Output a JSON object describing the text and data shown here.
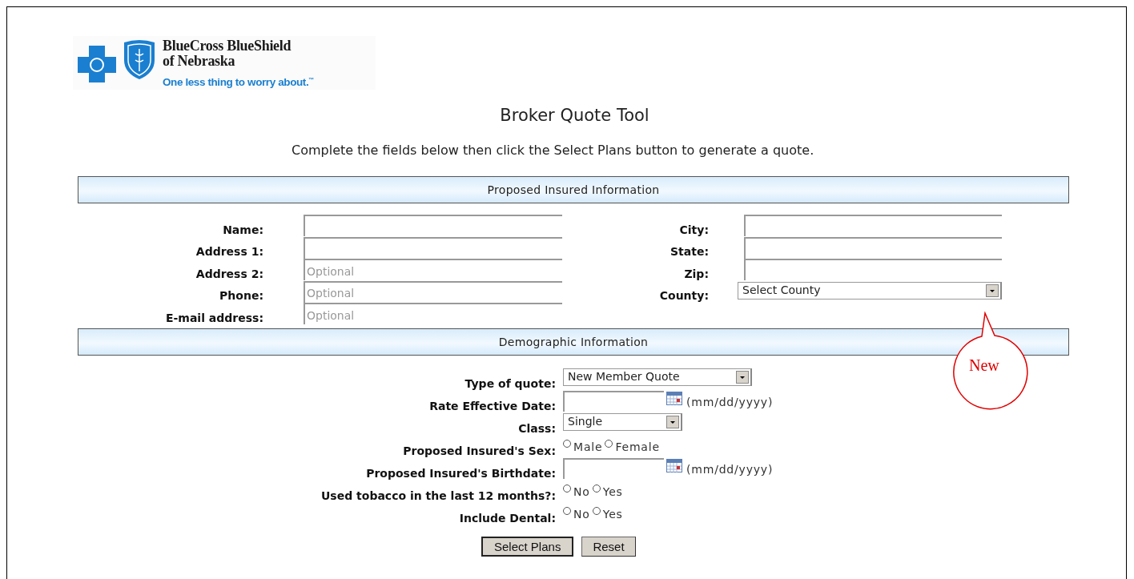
{
  "logo": {
    "line1": "BlueCross BlueShield",
    "line2": "of Nebraska",
    "tagline": "One less thing to worry about.$^{™}$"
  },
  "title": "Broker Quote Tool",
  "instructions": "Complete the fields below then click the Select Plans button to generate a quote.",
  "insured_section": {
    "heading": "Proposed Insured Information",
    "left_fields": [
      {
        "label": "Name:",
        "kind": "text"
      },
      {
        "label": "Address 1:",
        "kind": "text"
      },
      {
        "label": "Address 2:",
        "kind": "text",
        "placeholder": "Optional"
      },
      {
        "label": "Phone:",
        "kind": "text",
        "placeholder": "Optional"
      },
      {
        "label": "E-mail address:",
        "kind": "text",
        "placeholder": "Optional"
      }
    ],
    "right_fields": [
      {
        "label": "City:",
        "kind": "text"
      },
      {
        "label": "State:",
        "kind": "text"
      },
      {
        "label": "Zip:",
        "kind": "text"
      },
      {
        "label": "County:",
        "kind": "select",
        "value": "Select County"
      }
    ]
  },
  "callout": {
    "text": "New"
  },
  "demographic_section": {
    "heading": "Demographic Information",
    "rows": [
      {
        "label": "Type of quote:",
        "kind": "select",
        "value": "New Member Quote"
      },
      {
        "label": "Rate Effective Date:",
        "kind": "date",
        "hint": "(mm/dd/yyyy)"
      },
      {
        "label": "Class:",
        "kind": "select",
        "value": "Single"
      },
      {
        "label": "Proposed Insured's Sex:",
        "kind": "radio",
        "options": [
          {
            "label": "Male",
            "selected": false
          },
          {
            "label": "Female",
            "selected": false
          }
        ]
      },
      {
        "label": "Proposed Insured's Birthdate:",
        "kind": "date",
        "hint": "(mm/dd/yyyy)"
      },
      {
        "label": "Used tobacco in the last 12 months?:",
        "kind": "radio",
        "options": [
          {
            "label": "No",
            "selected": false
          },
          {
            "label": "Yes",
            "selected": false
          }
        ]
      },
      {
        "label": "Include Dental:",
        "kind": "radio",
        "options": [
          {
            "label": "No",
            "selected": false
          },
          {
            "label": "Yes",
            "selected": false
          }
        ]
      }
    ]
  },
  "buttons": [
    "Select Plans",
    "Reset"
  ]
}
